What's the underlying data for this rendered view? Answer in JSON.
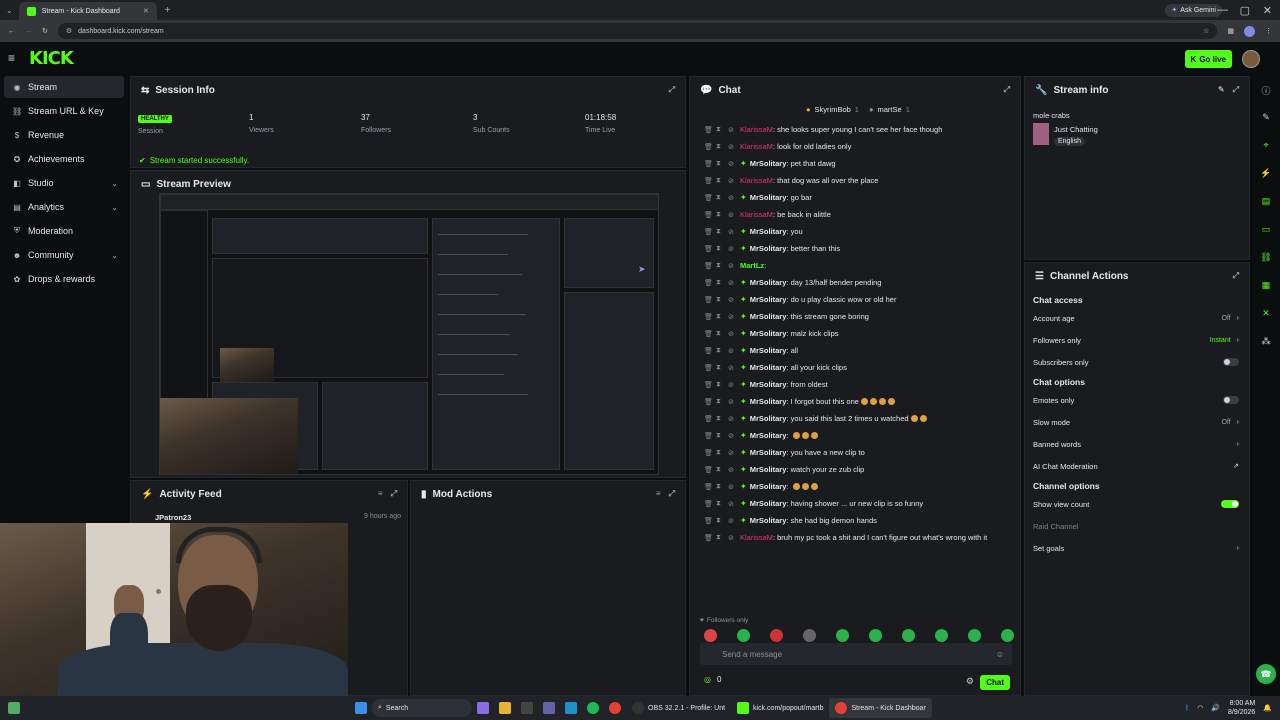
{
  "browser": {
    "tab_title": "Stream - Kick Dashboard",
    "url": "dashboard.kick.com/stream",
    "ask_gemini": "Ask Gemini"
  },
  "topbar": {
    "logo": "KICK",
    "go_live": "Go live",
    "brand_color": "#53fc18"
  },
  "sidebar": {
    "items": [
      {
        "label": "Stream",
        "icon": "stream-icon"
      },
      {
        "label": "Stream URL & Key",
        "icon": "link-icon"
      },
      {
        "label": "Revenue",
        "icon": "dollar-icon"
      },
      {
        "label": "Achievements",
        "icon": "trophy-icon"
      },
      {
        "label": "Studio",
        "icon": "studio-icon"
      },
      {
        "label": "Analytics",
        "icon": "chart-icon"
      },
      {
        "label": "Moderation",
        "icon": "shield-icon"
      },
      {
        "label": "Community",
        "icon": "community-icon"
      },
      {
        "label": "Drops & rewards",
        "icon": "gift-icon"
      }
    ]
  },
  "session": {
    "title": "Session Info",
    "status": "HEALTHY",
    "status_label": "Session",
    "viewers": "1",
    "viewers_label": "Viewers",
    "followers": "37",
    "followers_label": "Followers",
    "subs": "3",
    "subs_label": "Sub Counts",
    "time": "01:18:58",
    "time_label": "Time Live",
    "success": "Stream started successfully."
  },
  "preview": {
    "title": "Stream Preview"
  },
  "activity": {
    "title": "Activity Feed",
    "items": [
      {
        "user": "JPatron23",
        "time": "9 hours ago"
      }
    ]
  },
  "mod": {
    "title": "Mod Actions"
  },
  "chat": {
    "title": "Chat",
    "pinned": [
      "SkyrimBob",
      "1",
      "martSe",
      "1"
    ],
    "messages": [
      {
        "user": "KlarissaM",
        "text": "she looks super young I can't see her face though",
        "color": "red"
      },
      {
        "user": "KlarissaM",
        "text": "look for old ladies only",
        "color": "red"
      },
      {
        "user": "MrSolitary",
        "text": "pet that dawg",
        "color": "white"
      },
      {
        "user": "KlarissaM",
        "text": "that dog was all over the place",
        "color": "red"
      },
      {
        "user": "MrSolitary",
        "text": "go bar",
        "color": "white"
      },
      {
        "user": "KlarissaM",
        "text": "be back in alittle",
        "color": "red"
      },
      {
        "user": "MrSolitary",
        "text": "you",
        "color": "white"
      },
      {
        "user": "MrSolitary",
        "text": "better than this",
        "color": "white"
      },
      {
        "user": "MartLz",
        "text": "",
        "color": "green"
      },
      {
        "user": "MrSolitary",
        "text": "day 13/half bender pending",
        "color": "white"
      },
      {
        "user": "MrSolitary",
        "text": "do u play classic wow or old her",
        "color": "white"
      },
      {
        "user": "MrSolitary",
        "text": "this stream gone boring",
        "color": "white"
      },
      {
        "user": "MrSolitary",
        "text": "malz kick clips",
        "color": "white"
      },
      {
        "user": "MrSolitary",
        "text": "all",
        "color": "white"
      },
      {
        "user": "MrSolitary",
        "text": "all your kick clips",
        "color": "white"
      },
      {
        "user": "MrSolitary",
        "text": "from oldest",
        "color": "white"
      },
      {
        "user": "MrSolitary",
        "text": "I forgot bout this one",
        "color": "white",
        "emotes": 4
      },
      {
        "user": "MrSolitary",
        "text": "you said this last 2 times u watched",
        "color": "white",
        "emotes": 2
      },
      {
        "user": "MrSolitary",
        "text": "",
        "color": "white",
        "emotes": 3
      },
      {
        "user": "MrSolitary",
        "text": "you have a new clip to",
        "color": "white"
      },
      {
        "user": "MrSolitary",
        "text": "watch your ze zub clip",
        "color": "white"
      },
      {
        "user": "MrSolitary",
        "text": "",
        "color": "white",
        "emotes": 3
      },
      {
        "user": "MrSolitary",
        "text": "having shower ... ur new clip is so funny",
        "color": "white"
      },
      {
        "user": "MrSolitary",
        "text": "she had big demon hands",
        "color": "white"
      },
      {
        "user": "KlarissaM",
        "text": "bruh my pc took a shit and I can't figure out what's wrong with it",
        "color": "red"
      }
    ],
    "followers_only": "Followers only",
    "placeholder": "Send a message",
    "count": "0",
    "send": "Chat"
  },
  "streaminfo": {
    "title": "Stream info",
    "stream_title": "mole crabs",
    "category": "Just Chatting",
    "language": "English"
  },
  "channel": {
    "title": "Channel Actions",
    "chat_access": "Chat access",
    "account_age": "Account age",
    "account_age_val": "Off",
    "followers_only": "Followers only",
    "followers_only_val": "Instant",
    "subscribers_only": "Subscribers only",
    "chat_options": "Chat options",
    "emotes_only": "Emotes only",
    "slow_mode": "Slow mode",
    "slow_mode_val": "Off",
    "banned_words": "Banned words",
    "ai_mod": "AI Chat Moderation",
    "channel_options": "Channel options",
    "show_view_count": "Show view count",
    "raid_channel": "Raid Channel",
    "set_goals": "Set goals"
  },
  "taskbar": {
    "search": "Search",
    "obs": "OBS 32.2.1 - Profile: Unt",
    "popout": "kick.com/popout/martb",
    "dashboard": "Stream - Kick Dashboar",
    "time": "8:00 AM",
    "date": "8/9/2026"
  }
}
